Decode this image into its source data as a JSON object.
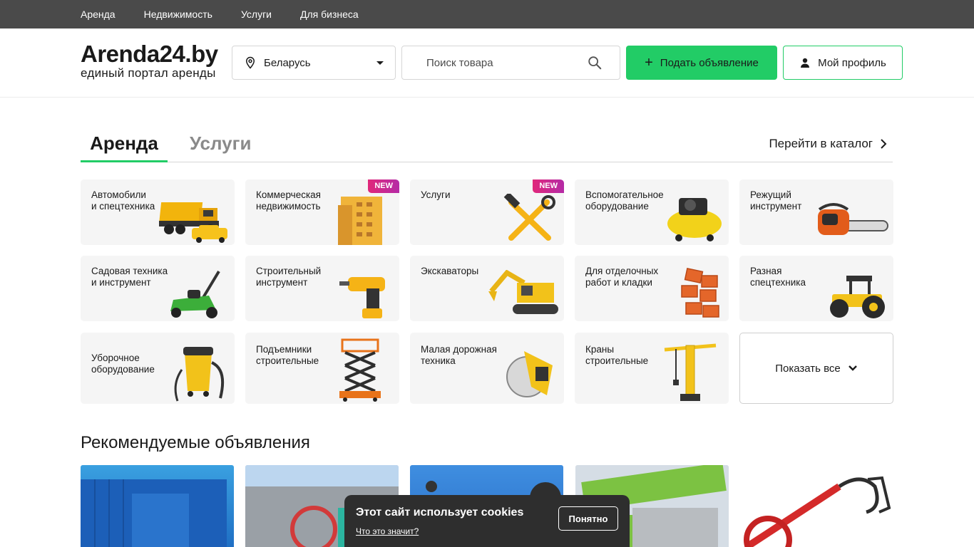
{
  "topnav": {
    "items": [
      "Аренда",
      "Недвижимость",
      "Услуги",
      "Для бизнеса"
    ]
  },
  "header": {
    "logo_title": "Arenda24.by",
    "logo_subtitle": "единый портал аренды",
    "region": "Беларусь",
    "search_placeholder": "Поиск товара",
    "post_button": "Подать объявление",
    "profile_button": "Мой профиль"
  },
  "tabs": {
    "active": "Аренда",
    "inactive": "Услуги",
    "catalog_link": "Перейти в каталог"
  },
  "categories": [
    {
      "label": "Автомобили\nи спецтехника",
      "icon": "dump-truck-icon",
      "badge": ""
    },
    {
      "label": "Коммерческая\nнедвижимость",
      "icon": "building-icon",
      "badge": "NEW"
    },
    {
      "label": "Услуги",
      "icon": "hammer-wrench-icon",
      "badge": "NEW"
    },
    {
      "label": "Вспомогательное\nоборудование",
      "icon": "compressor-icon",
      "badge": ""
    },
    {
      "label": "Режущий\nинструмент",
      "icon": "chainsaw-icon",
      "badge": ""
    },
    {
      "label": "Садовая техника\nи инструмент",
      "icon": "lawnmower-icon",
      "badge": ""
    },
    {
      "label": "Строительный\nинструмент",
      "icon": "drill-icon",
      "badge": ""
    },
    {
      "label": "Экскаваторы",
      "icon": "excavator-icon",
      "badge": ""
    },
    {
      "label": "Для отделочных\nработ и кладки",
      "icon": "bricks-icon",
      "badge": ""
    },
    {
      "label": "Разная\nспецтехника",
      "icon": "tractor-icon",
      "badge": ""
    },
    {
      "label": "Уборочное\nоборудование",
      "icon": "vacuum-icon",
      "badge": ""
    },
    {
      "label": "Подъемники\nстроительные",
      "icon": "scissor-lift-icon",
      "badge": ""
    },
    {
      "label": "Малая дорожная\nтехника",
      "icon": "road-saw-icon",
      "badge": ""
    },
    {
      "label": "Краны\nстроительные",
      "icon": "tower-crane-icon",
      "badge": ""
    }
  ],
  "show_all": "Показать все",
  "recommended": {
    "title": "Рекомендуемые объявления"
  },
  "cookie": {
    "title": "Этот сайт использует cookies",
    "link": "Что это значит?",
    "button": "Понятно"
  },
  "colors": {
    "accent": "#22cc66",
    "topbar": "#4a4a4a",
    "badge": "#d8298a"
  }
}
